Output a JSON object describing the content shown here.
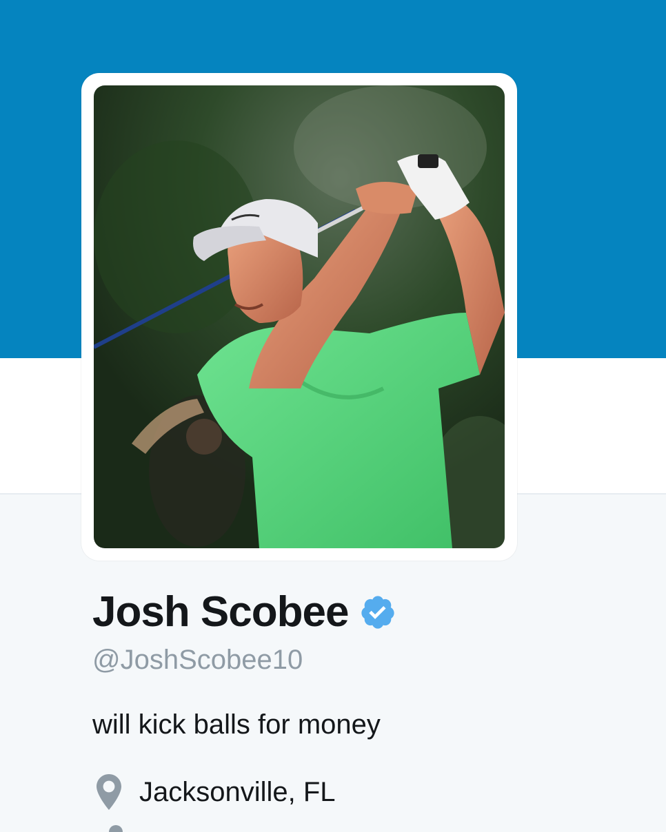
{
  "profile": {
    "display_name": "Josh Scobee",
    "screen_name": "@JoshScobee10",
    "bio": "will kick balls for money",
    "location": "Jacksonville, FL",
    "verified": true
  },
  "icons": {
    "verified": "verified-badge-icon",
    "location": "map-pin-icon"
  },
  "colors": {
    "banner": "#0584bf",
    "verified_badge": "#55acee",
    "text_primary": "#14171a",
    "text_secondary": "#8f9ba5",
    "profile_background": "#f5f8fa"
  }
}
